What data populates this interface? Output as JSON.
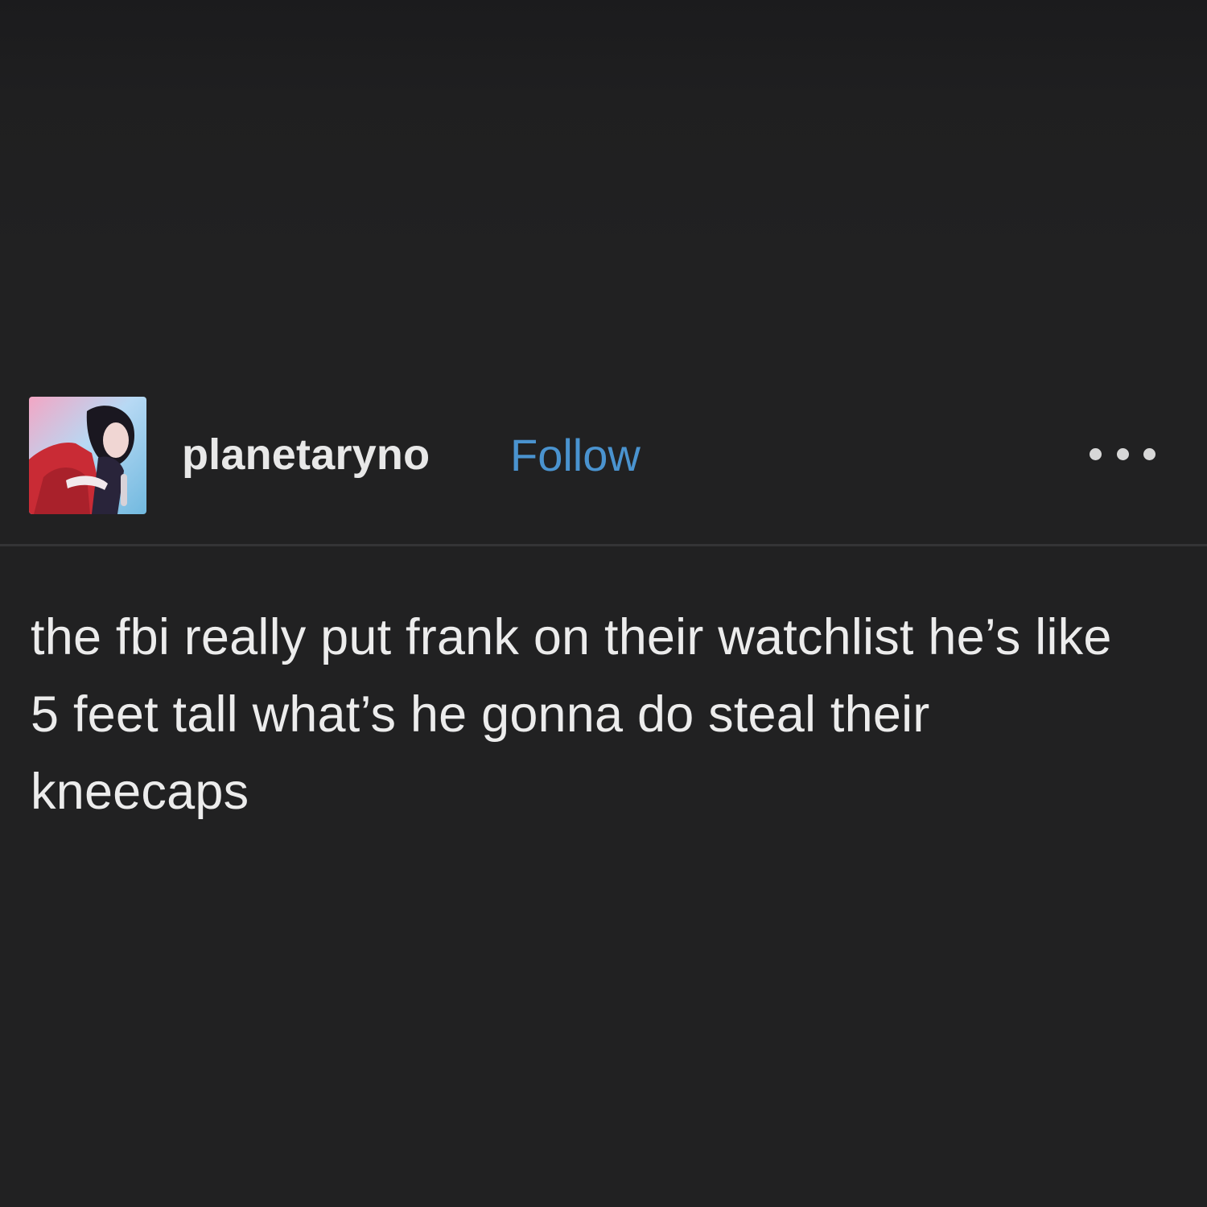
{
  "post": {
    "avatar_label": "avatar",
    "username": "planetaryno",
    "follow_label": "Follow",
    "more_icon": "more-horizontal-icon",
    "body_text": "the fbi really put frank on their watchlist he’s like 5 feet tall what’s he gonna do steal their kneecaps"
  },
  "colors": {
    "background": "#212122",
    "accent": "#4a93cf",
    "text": "#ececec"
  }
}
